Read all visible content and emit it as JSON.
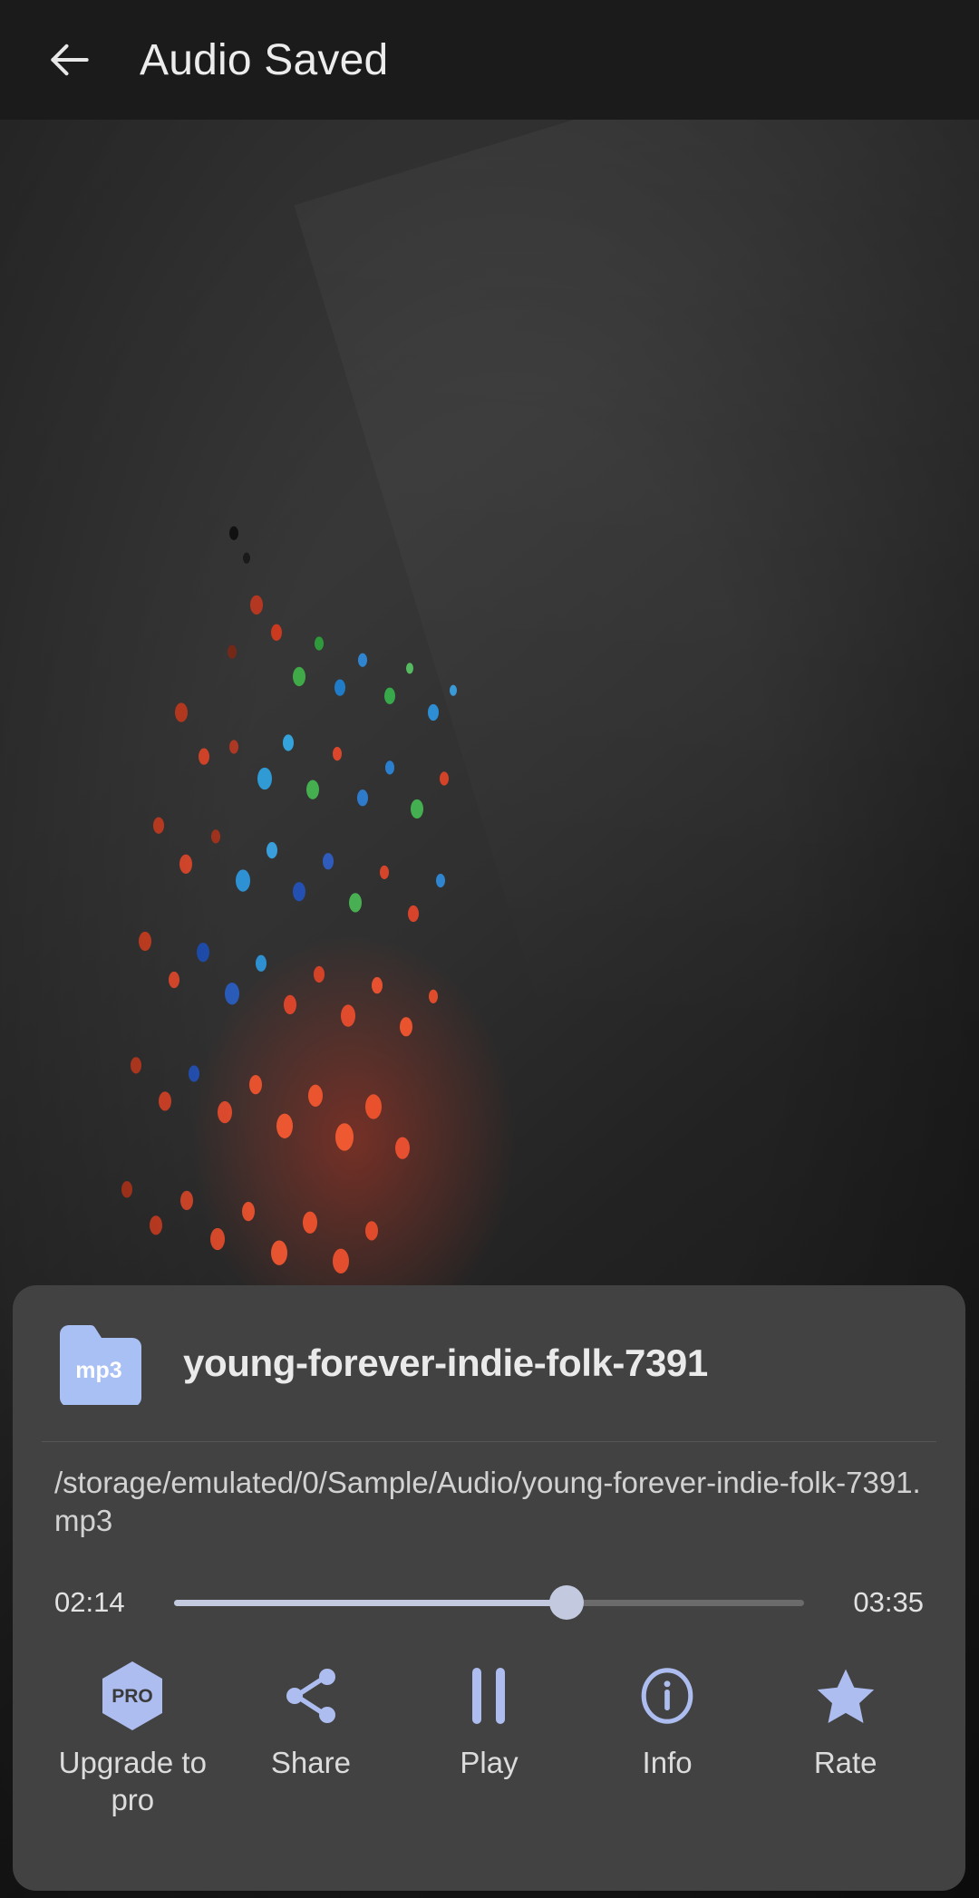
{
  "appbar": {
    "back_icon": "arrow-left-icon",
    "title": "Audio Saved"
  },
  "artwork": {
    "alt": "music-note-artwork",
    "description": "white eighth note with colorful note particles on dark gradient"
  },
  "file": {
    "type_badge": "mp3",
    "name": "young-forever-indie-folk-7391",
    "path": "/storage/emulated/0/Sample/Audio/young-forever-indie-folk-7391.mp3"
  },
  "player": {
    "current_time": "02:14",
    "total_time": "03:35",
    "progress_percent": 62.3,
    "thumb_color": "#c3cae0",
    "track_color": "#6b6b6b",
    "fill_color": "#c3cae0"
  },
  "actions": [
    {
      "icon": "pro-badge-icon",
      "label": "Upgrade to pro"
    },
    {
      "icon": "share-icon",
      "label": "Share"
    },
    {
      "icon": "pause-icon",
      "label": "Play"
    },
    {
      "icon": "info-circle-icon",
      "label": "Info"
    },
    {
      "icon": "star-icon",
      "label": "Rate"
    }
  ],
  "colors": {
    "accent": "#aebdf0",
    "card_bg": "#424242",
    "screen_bg": "#1b1b1b",
    "folder_icon": "#a9c0f5"
  }
}
